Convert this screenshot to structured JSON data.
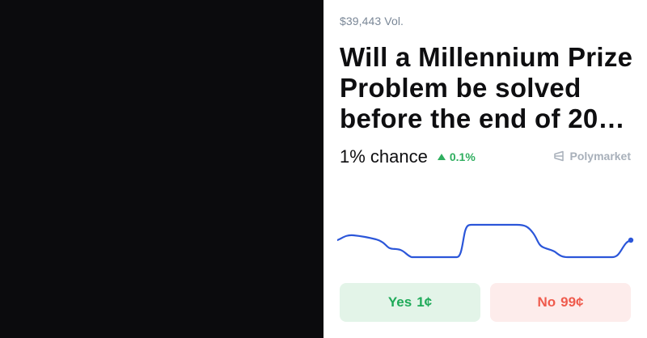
{
  "market": {
    "volume": "$39,443 Vol.",
    "title": "Will a Millennium Prize Problem be solved before the end of 20…",
    "chance": "1% chance",
    "delta": "0.1%",
    "brand": "Polymarket"
  },
  "buttons": {
    "yes_label": "Yes",
    "yes_price": "1¢",
    "no_label": "No",
    "no_price": "99¢"
  },
  "colors": {
    "line": "#2b56d9",
    "positive": "#2fae5f",
    "yes_bg": "#e3f4e8",
    "yes_text": "#1faa59",
    "no_bg": "#fdeceb",
    "no_text": "#ef5b4d"
  },
  "icons": {
    "delta": "triangle-up-icon",
    "brand": "polymarket-logo-icon"
  }
}
